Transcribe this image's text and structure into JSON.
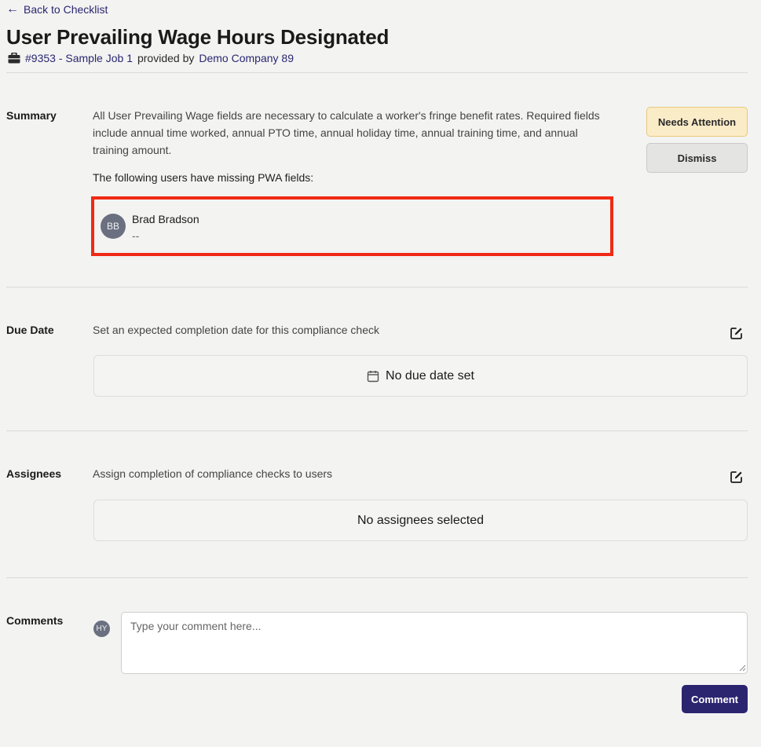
{
  "header": {
    "back_label": "Back to Checklist",
    "title": "User Prevailing Wage Hours Designated",
    "job_link": "#9353 - Sample Job 1",
    "provided_by": "provided by",
    "company_link": "Demo Company 89"
  },
  "summary": {
    "label": "Summary",
    "text": "All User Prevailing Wage fields are necessary to calculate a worker's fringe benefit rates. Required fields include annual time worked, annual PTO time, annual holiday time, annual training time, and annual training amount.",
    "missing_label": "The following users have missing PWA fields:",
    "users": [
      {
        "initials": "BB",
        "name": "Brad Bradson",
        "detail": "--"
      }
    ],
    "status_button": "Needs Attention",
    "dismiss_button": "Dismiss"
  },
  "due_date": {
    "label": "Due Date",
    "description": "Set an expected completion date for this compliance check",
    "empty_text": "No due date set"
  },
  "assignees": {
    "label": "Assignees",
    "description": "Assign completion of compliance checks to users",
    "empty_text": "No assignees selected"
  },
  "comments": {
    "label": "Comments",
    "avatar_initials": "HY",
    "placeholder": "Type your comment here...",
    "value": "",
    "submit_label": "Comment"
  },
  "colors": {
    "link": "#2a2770",
    "highlight_border": "#f02a14",
    "needs_attention_bg": "#fbecc8",
    "primary_button": "#2b2570"
  },
  "icons": [
    "arrow-left-icon",
    "briefcase-icon",
    "edit-icon",
    "calendar-icon"
  ]
}
